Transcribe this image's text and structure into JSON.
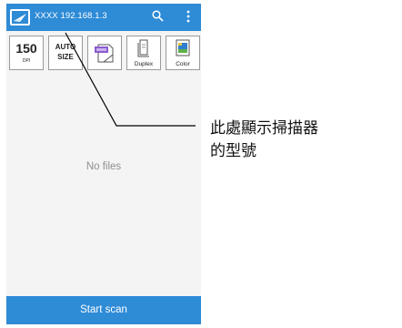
{
  "app": {
    "title": "XXXX  192.168.1.3",
    "logo_icon": "scanner-logo-icon",
    "search_icon": "search-icon",
    "menu_icon": "more-vert-icon",
    "accent_color": "#2e8bd6"
  },
  "toolbar": {
    "dpi_value": "150",
    "dpi_unit": "DPI",
    "auto_line1": "AUTO",
    "auto_line2": "SIZE",
    "jpeg_icon": "jpeg-file-icon",
    "duplex_label": "Duplex",
    "color_label": "Color"
  },
  "main": {
    "empty_text": "No files"
  },
  "footer": {
    "start_label": "Start scan"
  },
  "annotation": {
    "line1": "此處顯示掃描器",
    "line2": "的型號"
  }
}
